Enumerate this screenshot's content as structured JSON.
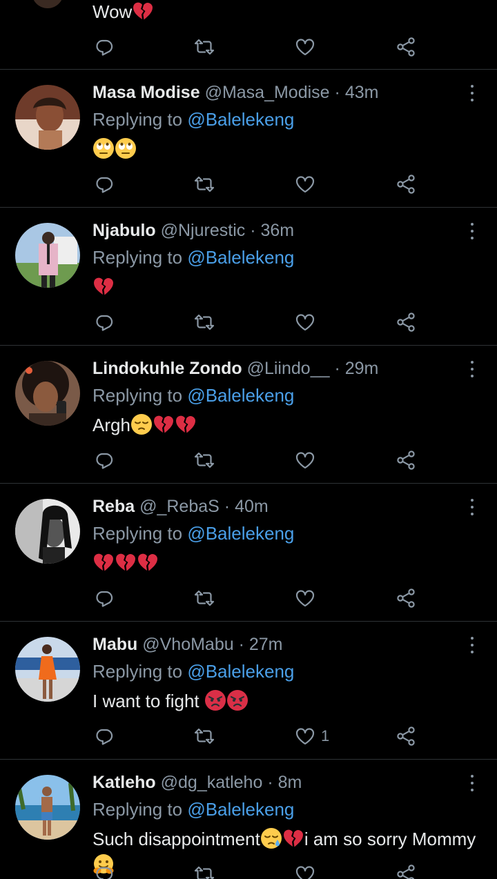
{
  "top_partial": {
    "text": "Wow",
    "emojis": [
      "broken-heart"
    ]
  },
  "common": {
    "replying_prefix": "Replying to",
    "replying_to": "@Balelekeng",
    "dot": "·"
  },
  "tweets": [
    {
      "name": "Masa Modise",
      "handle": "@Masa_Modise",
      "time": "43m",
      "text": "",
      "emojis": [
        "face-with-rolling-eyes",
        "face-with-rolling-eyes"
      ],
      "likes": "",
      "avatar": "woman-smiling"
    },
    {
      "name": "Njabulo",
      "handle": "@Njurestic",
      "time": "36m",
      "text": "",
      "emojis": [
        "broken-heart"
      ],
      "likes": "",
      "avatar": "man-pink-suit"
    },
    {
      "name": "Lindokuhle Zondo",
      "handle": "@Liindo__",
      "time": "29m",
      "text": "Argh",
      "emojis": [
        "pensive-face",
        "broken-heart",
        "broken-heart"
      ],
      "likes": "",
      "avatar": "woman-afro"
    },
    {
      "name": "Reba",
      "handle": "@_RebaS",
      "time": "40m",
      "text": "",
      "emojis": [
        "broken-heart",
        "broken-heart",
        "broken-heart"
      ],
      "likes": "",
      "avatar": "woman-braids-bw"
    },
    {
      "name": "Mabu",
      "handle": "@VhoMabu",
      "time": "27m",
      "text": "I want to fight ",
      "emojis": [
        "pouting-face",
        "pouting-face"
      ],
      "likes": "1",
      "avatar": "woman-orange-dress"
    },
    {
      "name": "Katleho",
      "handle": "@dg_katleho",
      "time": "8m",
      "text": "Such disappointment",
      "emojis": [
        "sad-face-tear",
        "broken-heart"
      ],
      "text2": "i am so sorry Mommy",
      "emojis2": [
        "hugging-face"
      ],
      "likes": "",
      "avatar": "man-beach"
    }
  ],
  "colors": {
    "background": "#000000",
    "mention": "#4a9fe8",
    "muted": "#8b98a5",
    "text": "#e7e9ea",
    "divider": "#2f3336"
  }
}
